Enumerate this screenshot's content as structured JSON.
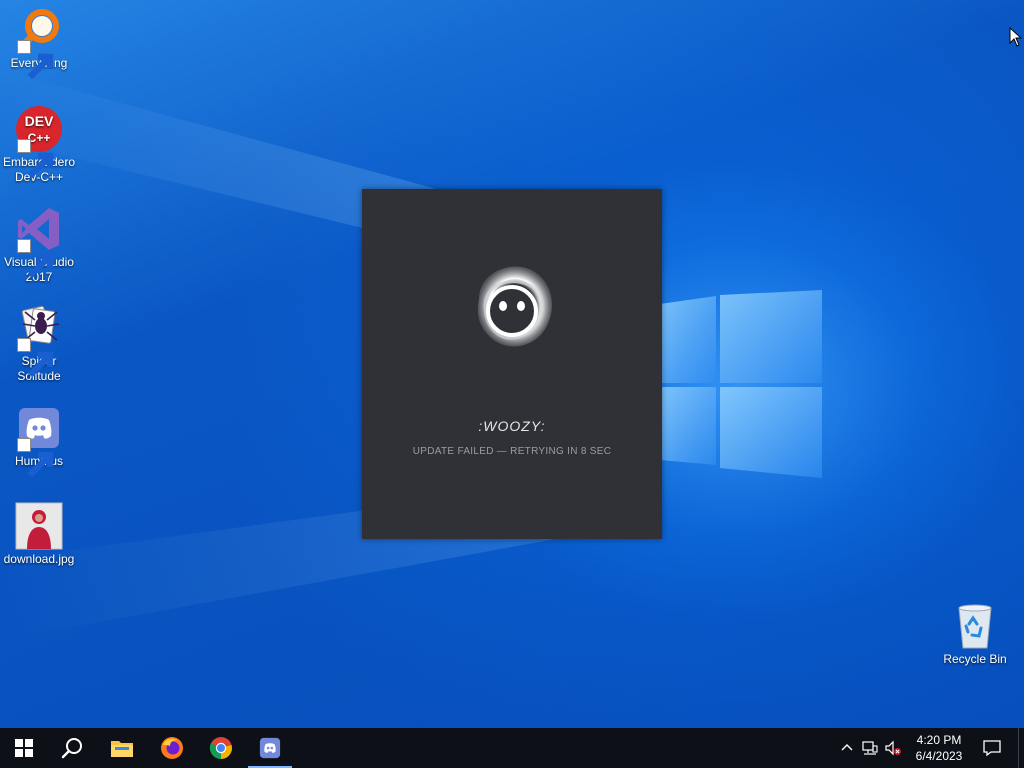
{
  "desktop": {
    "icons": [
      {
        "label": "Everything",
        "icon": "everything-search-icon"
      },
      {
        "label": "Embarcadero Dev-C++",
        "icon": "devcpp-icon"
      },
      {
        "label": "Visual Studio 2017",
        "icon": "visual-studio-icon"
      },
      {
        "label": "Spider Solitude",
        "icon": "spider-solitaire-icon"
      },
      {
        "label": "Hummus",
        "icon": "discord-icon"
      },
      {
        "label": "download.jpg",
        "icon": "image-thumbnail"
      }
    ],
    "recycle_bin": {
      "label": "Recycle Bin",
      "icon": "recycle-bin-icon"
    }
  },
  "splash": {
    "title": ":WOOZY:",
    "status": "UPDATE FAILED — RETRYING IN 8 SEC",
    "bg_color": "#2f3136"
  },
  "taskbar": {
    "apps": [
      {
        "name": "Start",
        "icon": "windows-start-icon"
      },
      {
        "name": "Search",
        "icon": "search-icon"
      },
      {
        "name": "File Explorer",
        "icon": "folder-icon"
      },
      {
        "name": "Firefox",
        "icon": "firefox-icon"
      },
      {
        "name": "Chrome",
        "icon": "chrome-icon"
      },
      {
        "name": "Discord",
        "icon": "discord-icon"
      }
    ],
    "tray": {
      "icons": [
        "chevron-up-icon",
        "network-icon",
        "volume-muted-icon"
      ],
      "time": "4:20 PM",
      "date": "6/4/2023"
    }
  },
  "colors": {
    "wallpaper": "#0a5fd0",
    "taskbar": "#0d1117",
    "accent": "#7fb6ff"
  }
}
